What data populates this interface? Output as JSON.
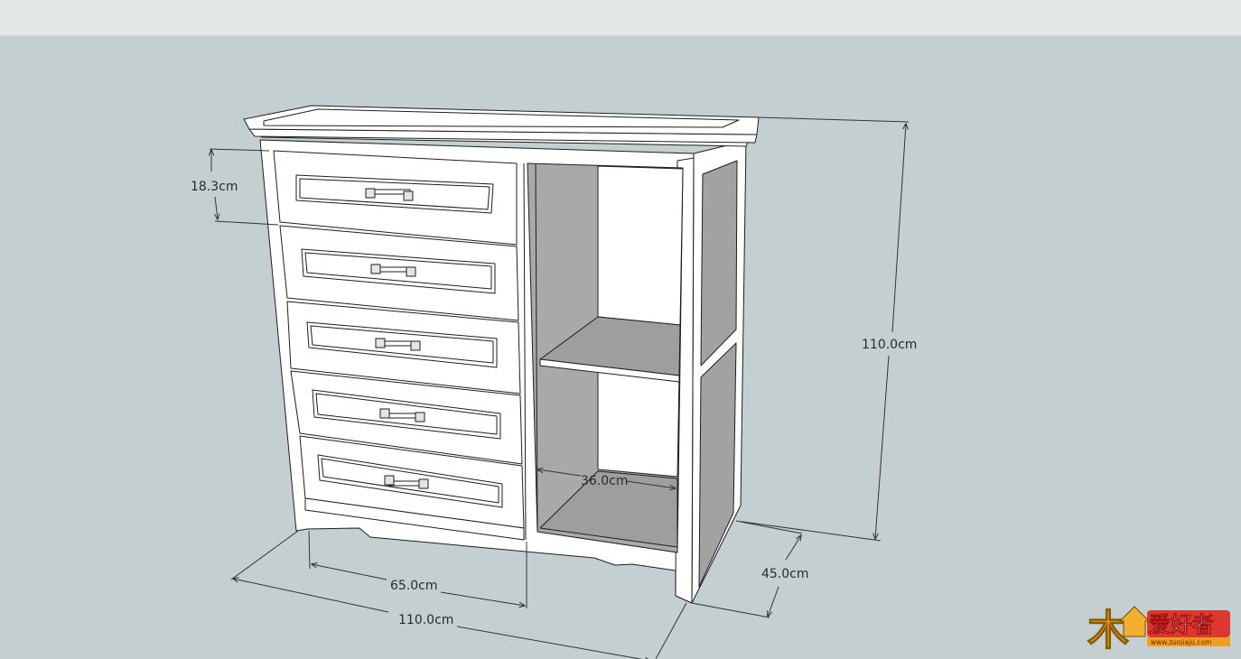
{
  "dimensions": {
    "drawer_height": "18.3cm",
    "total_height": "110.0cm",
    "shelf_width": "36.0cm",
    "drawer_width": "65.0cm",
    "total_width": "110.0cm",
    "depth": "45.0cm"
  },
  "logo": {
    "text": "爱好者",
    "glyph": "木",
    "url": "www.zuojiaju.com"
  },
  "colors": {
    "background": "#c3cfd1",
    "topbar": "#e3e7e8",
    "face": "#ffffff",
    "shadow": "#9c9c9c",
    "line": "#1e1e1e",
    "logo_orange": "#f0a020",
    "logo_red": "#e0261d"
  }
}
